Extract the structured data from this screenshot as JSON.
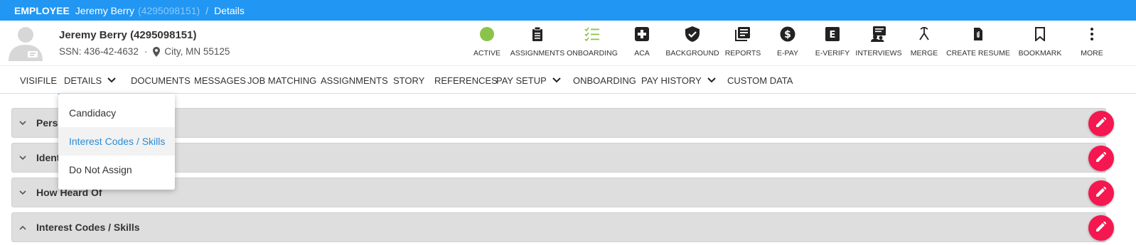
{
  "breadcrumb": {
    "type": "EMPLOYEE",
    "name": "Jeremy Berry",
    "id": "(4295098151)",
    "separator": "/",
    "page": "Details"
  },
  "employee": {
    "name": "Jeremy Berry (4295098151)",
    "ssn": "SSN: 436-42-4632",
    "dot": "·",
    "location": "City, MN 55125"
  },
  "actions": [
    {
      "label": "ACTIVE",
      "icon": "status-dot-icon"
    },
    {
      "label": "ASSIGNMENTS",
      "icon": "clipboard-icon"
    },
    {
      "label": "ONBOARDING",
      "icon": "checklist-icon"
    },
    {
      "label": "ACA",
      "icon": "medical-plus-icon"
    },
    {
      "label": "BACKGROUND",
      "icon": "shield-check-icon"
    },
    {
      "label": "REPORTS",
      "icon": "reports-icon"
    },
    {
      "label": "E-PAY",
      "icon": "dollar-icon"
    },
    {
      "label": "E-VERIFY",
      "icon": "e-verify-icon"
    },
    {
      "label": "INTERVIEWS",
      "icon": "interviews-icon"
    },
    {
      "label": "MERGE",
      "icon": "merge-icon"
    },
    {
      "label": "CREATE RESUME",
      "icon": "paperclip-icon"
    },
    {
      "label": "BOOKMARK",
      "icon": "bookmark-icon"
    },
    {
      "label": "MORE",
      "icon": "more-vert-icon"
    }
  ],
  "tabs": [
    {
      "label": "VISIFILE"
    },
    {
      "label": "DETAILS"
    },
    {
      "label": "DOCUMENTS"
    },
    {
      "label": "MESSAGES"
    },
    {
      "label": "JOB MATCHING"
    },
    {
      "label": "ASSIGNMENTS"
    },
    {
      "label": "STORY"
    },
    {
      "label": "REFERENCES"
    },
    {
      "label": "PAY SETUP"
    },
    {
      "label": "ONBOARDING"
    },
    {
      "label": "PAY HISTORY"
    },
    {
      "label": "CUSTOM DATA"
    }
  ],
  "dropdown": {
    "items": [
      "Candidacy",
      "Interest Codes / Skills",
      "Do Not Assign"
    ],
    "selected": "Interest Codes / Skills"
  },
  "panels": [
    {
      "title": "Perso",
      "expanded": false
    },
    {
      "title": "Ident",
      "expanded": false
    },
    {
      "title": "How Heard Of",
      "expanded": false
    },
    {
      "title": "Interest Codes / Skills",
      "expanded": true
    }
  ],
  "colors": {
    "topbar": "#2196f3",
    "active_status": "#8bc34a",
    "onboarding_icon": "#8bc34a",
    "edit_button": "#f5174f",
    "selected_item": "#2b8cd6"
  }
}
